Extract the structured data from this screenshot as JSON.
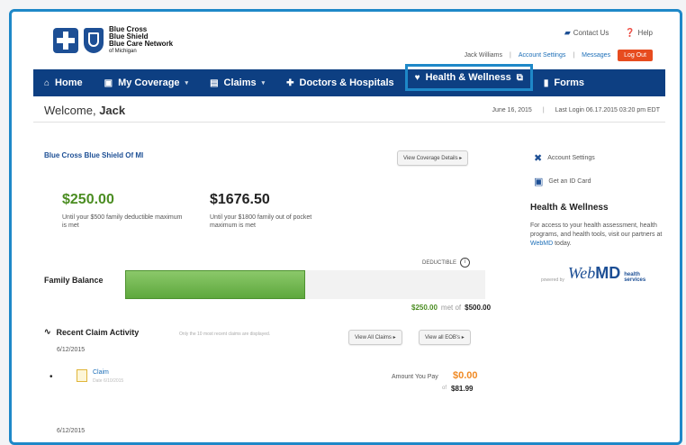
{
  "brand": {
    "line1": "Blue Cross",
    "line2": "Blue Shield",
    "line3": "Blue Care Network",
    "line4": "of Michigan"
  },
  "top_links": {
    "contact": "Contact Us",
    "help": "Help"
  },
  "user_bar": {
    "user_name": "Jack Williams",
    "account_settings": "Account Settings",
    "messages": "Messages",
    "logout": "Log Out"
  },
  "nav": {
    "home": "Home",
    "coverage": "My Coverage",
    "claims": "Claims",
    "doctors": "Doctors & Hospitals",
    "health": "Health & Wellness",
    "forms": "Forms"
  },
  "welcome": {
    "prefix": "Welcome,",
    "name": "Jack",
    "date": "June 16, 2015",
    "last_login": "Last Login 06.17.2015 03:20 pm EDT"
  },
  "coverage": {
    "plan_name": "Blue Cross Blue Shield Of MI",
    "view_details": "View Coverage Details ▸",
    "deductible_amount": "$250.00",
    "deductible_desc": "Until your $500 family deductible maximum is met",
    "oop_amount": "$1676.50",
    "oop_desc": "Until your $1800 family out of pocket maximum is met"
  },
  "balance": {
    "toggle_label": "DEDUCTIBLE",
    "label": "Family Balance",
    "fill_fraction": 0.5,
    "met": "$250.00",
    "of_text": "met of",
    "max": "$500.00"
  },
  "claims": {
    "title": "Recent Claim Activity",
    "note": "Only the 10 most recent claims are displayed.",
    "view_all_claims": "View All Claims ▸",
    "view_all_eobs": "View all EOB's ▸",
    "date1": "6/12/2015",
    "claim_label": "Claim",
    "claim_sub": "Date 6/10/2015",
    "pay_label": "Amount You Pay",
    "pay_amount": "$0.00",
    "total_prefix": "of",
    "total_amount": "$81.99",
    "date2": "6/12/2015"
  },
  "sidebar": {
    "account_settings": "Account Settings",
    "get_id_card": "Get an ID Card",
    "hw_title": "Health & Wellness",
    "hw_text_1": "For access to your health assessment, health programs, and health tools, visit our partners at",
    "hw_link": "WebMD",
    "hw_text_2": "today.",
    "powered_by": "powered by",
    "webmd_web": "Web",
    "webmd_md": "MD",
    "webmd_hs1": "health",
    "webmd_hs2": "services"
  },
  "colors": {
    "nav_bg": "#0d3f82",
    "highlight": "#1e88c8",
    "balance_fill": "#6cb447",
    "pay_amount": "#f08a24",
    "logout": "#e74c1f"
  }
}
